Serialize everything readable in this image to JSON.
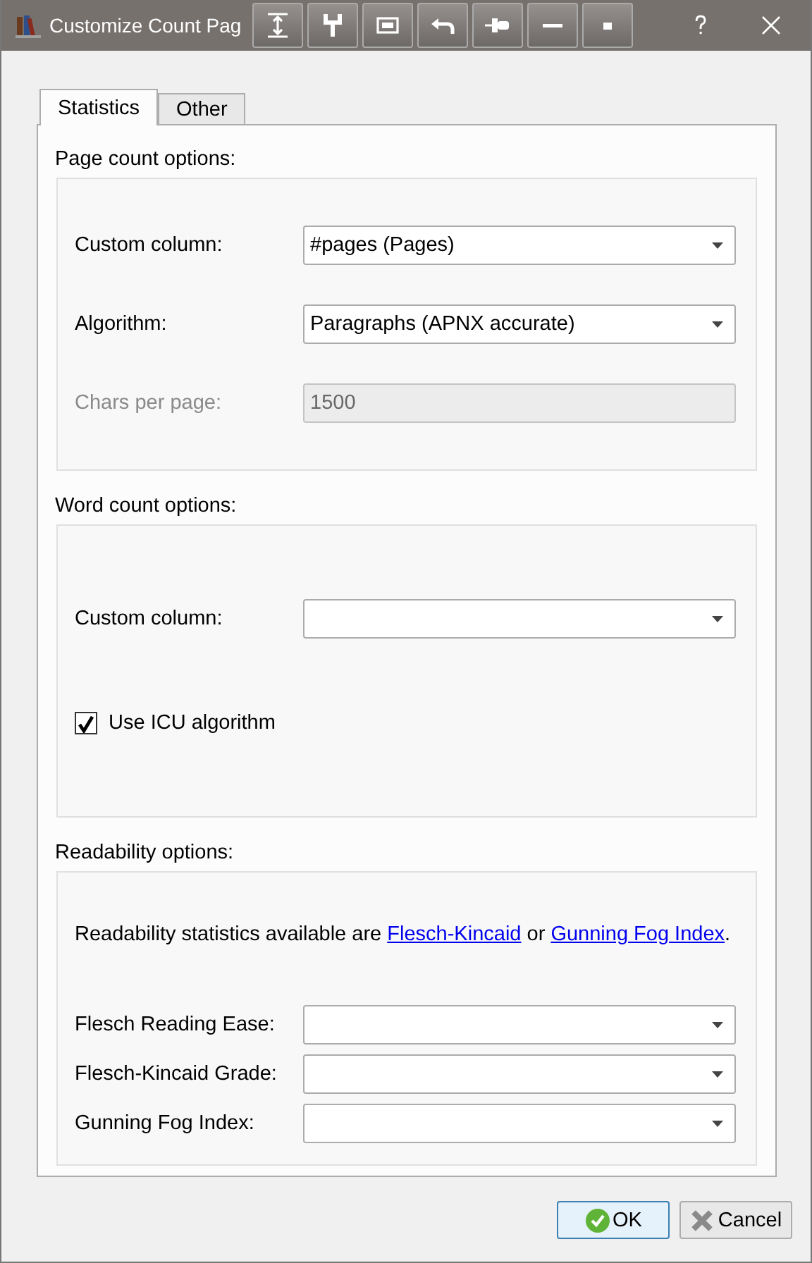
{
  "window": {
    "title": "Customize Count Pag"
  },
  "tabs": [
    {
      "label": "Statistics",
      "selected": true
    },
    {
      "label": "Other",
      "selected": false
    }
  ],
  "groups": [
    {
      "title": "Page count options:",
      "rows": [
        {
          "kind": "combo",
          "label": "Custom column:",
          "value": "#pages (Pages)",
          "disabled": false
        },
        {
          "kind": "combo",
          "label": "Algorithm:",
          "value": "Paragraphs (APNX accurate)",
          "disabled": false
        },
        {
          "kind": "spin",
          "label": "Chars per page:",
          "value": "1500",
          "disabled": true
        }
      ]
    },
    {
      "title": "Word count options:",
      "rows": [
        {
          "kind": "combo",
          "label": "Custom column:",
          "disabled": false
        },
        {
          "kind": "checkbox",
          "label": "Use ICU algorithm",
          "checked": true
        }
      ]
    },
    {
      "title": "Readability options:",
      "rows": [
        {
          "kind": "note",
          "parts": [
            {
              "text": "Readability statistics available are "
            },
            {
              "link": "Flesch-Kincaid"
            },
            {
              "text": " or "
            },
            {
              "link": "Gunning Fog Index"
            },
            {
              "text": "."
            }
          ]
        },
        {
          "kind": "combo",
          "label": "Flesch Reading Ease:",
          "disabled": false
        },
        {
          "kind": "combo",
          "label": "Flesch-Kincaid Grade:",
          "disabled": false
        },
        {
          "kind": "combo",
          "label": "Gunning Fog Index:",
          "disabled": false
        }
      ]
    }
  ],
  "buttons": [
    {
      "label": "OK",
      "kind": "ok",
      "default": true
    },
    {
      "label": "Cancel",
      "kind": "cancel",
      "default": false
    }
  ]
}
